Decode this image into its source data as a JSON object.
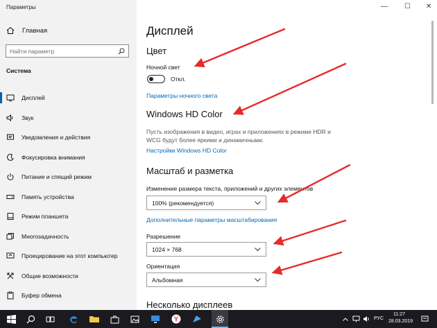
{
  "window": {
    "title": "Параметры",
    "minimize_glyph": "—",
    "maximize_glyph": "☐",
    "close_glyph": "✕"
  },
  "sidebar": {
    "home_label": "Главная",
    "search_placeholder": "Найти параметр",
    "section_title": "Система",
    "items": [
      {
        "label": "Дисплей",
        "icon": "display-icon",
        "active": true
      },
      {
        "label": "Звук",
        "icon": "sound-icon"
      },
      {
        "label": "Уведомления и действия",
        "icon": "notifications-icon"
      },
      {
        "label": "Фокусировка внимания",
        "icon": "focus-assist-icon"
      },
      {
        "label": "Питание и спящий режим",
        "icon": "power-icon"
      },
      {
        "label": "Память устройства",
        "icon": "storage-icon"
      },
      {
        "label": "Режим планшета",
        "icon": "tablet-icon"
      },
      {
        "label": "Многозадачность",
        "icon": "multitasking-icon"
      },
      {
        "label": "Проецирование на этот компьютер",
        "icon": "projecting-icon"
      },
      {
        "label": "Общие возможности",
        "icon": "shared-experiences-icon"
      },
      {
        "label": "Буфер обмена",
        "icon": "clipboard-icon"
      }
    ]
  },
  "main": {
    "page_title": "Дисплей",
    "color_heading": "Цвет",
    "night_light_label": "Ночной свет",
    "night_light_state": "Откл.",
    "night_light_link": "Параметры ночного света",
    "hdr_heading": "Windows HD Color",
    "hdr_desc": "Пусть изображения в видео, играх и приложениях в режиме HDR и WCG будут более яркими и динамичными.",
    "hdr_link": "Настройки Windows HD Color",
    "scale_heading": "Масштаб и разметка",
    "scale_label": "Изменение размера текста, приложений и других элементов",
    "scale_value": "100% (рекомендуется)",
    "advanced_scaling_link": "Дополнительные параметры масштабирования",
    "resolution_label": "Разрешение",
    "resolution_value": "1024 × 768",
    "orientation_label": "Ориентация",
    "orientation_value": "Альбомная",
    "multi_display_heading": "Несколько дисплеев"
  },
  "taskbar": {
    "language": "РУС",
    "time": "11:27",
    "date": "28.03.2019"
  },
  "colors": {
    "accent": "#0063b1",
    "link": "#0067b8",
    "arrow": "#e52b2b",
    "taskbar": "#1b1b1f"
  }
}
